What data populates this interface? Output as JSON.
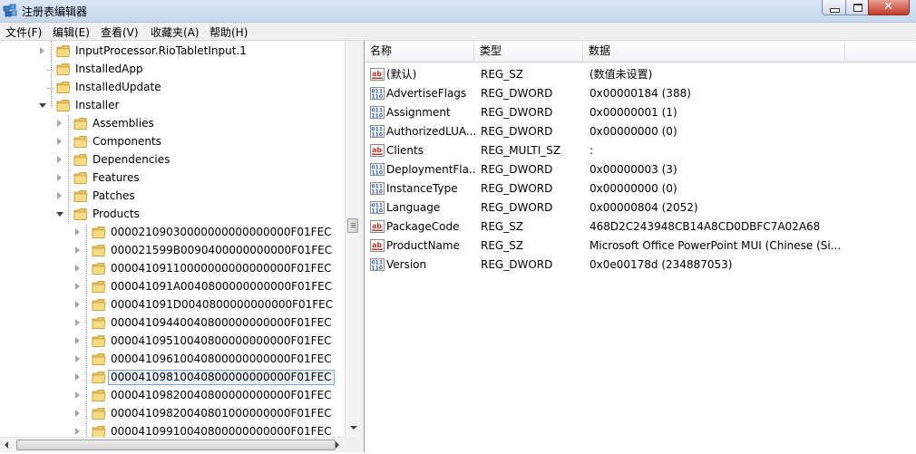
{
  "window": {
    "title": "注册表编辑器"
  },
  "menu": [
    "文件(F)",
    "编辑(E)",
    "查看(V)",
    "收藏夹(A)",
    "帮助(H)"
  ],
  "tree": {
    "items": [
      {
        "label": "InputProcessor.RioTabletInput.1",
        "level": 1,
        "expander": "closed"
      },
      {
        "label": "InstalledApp",
        "level": 1,
        "expander": "none"
      },
      {
        "label": "InstalledUpdate",
        "level": 1,
        "expander": "none"
      },
      {
        "label": "Installer",
        "level": 1,
        "expander": "open"
      },
      {
        "label": "Assemblies",
        "level": 2,
        "expander": "closed"
      },
      {
        "label": "Components",
        "level": 2,
        "expander": "closed"
      },
      {
        "label": "Dependencies",
        "level": 2,
        "expander": "closed"
      },
      {
        "label": "Features",
        "level": 2,
        "expander": "closed"
      },
      {
        "label": "Patches",
        "level": 2,
        "expander": "closed"
      },
      {
        "label": "Products",
        "level": 2,
        "expander": "open"
      },
      {
        "label": "00002109030000000000000000F01FEC",
        "level": 3,
        "expander": "closed"
      },
      {
        "label": "000021599B0090400000000000F01FEC",
        "level": 3,
        "expander": "closed"
      },
      {
        "label": "00004109110000000000000000F01FEC",
        "level": 3,
        "expander": "closed"
      },
      {
        "label": "000041091A0040800000000000F01FEC",
        "level": 3,
        "expander": "closed"
      },
      {
        "label": "000041091D0040800000000000F01FEC",
        "level": 3,
        "expander": "closed"
      },
      {
        "label": "00004109440040800000000000F01FEC",
        "level": 3,
        "expander": "closed"
      },
      {
        "label": "00004109510040800000000000F01FEC",
        "level": 3,
        "expander": "closed"
      },
      {
        "label": "00004109610040800000000000F01FEC",
        "level": 3,
        "expander": "closed"
      },
      {
        "label": "00004109810040800000000000F01FEC",
        "level": 3,
        "expander": "closed",
        "selected": true
      },
      {
        "label": "00004109820040800000000000F01FEC",
        "level": 3,
        "expander": "closed"
      },
      {
        "label": "00004109820040801000000000F01FEC",
        "level": 3,
        "expander": "closed"
      },
      {
        "label": "00004109910040800000000000F01FEC",
        "level": 3,
        "expander": "closed"
      }
    ]
  },
  "list": {
    "columns": [
      "名称",
      "类型",
      "数据"
    ],
    "rows": [
      {
        "name": "(默认)",
        "type": "REG_SZ",
        "data": "(数值未设置)",
        "icon": "string-value-icon"
      },
      {
        "name": "AdvertiseFlags",
        "type": "REG_DWORD",
        "data": "0x00000184 (388)",
        "icon": "binary-value-icon"
      },
      {
        "name": "Assignment",
        "type": "REG_DWORD",
        "data": "0x00000001 (1)",
        "icon": "binary-value-icon"
      },
      {
        "name": "AuthorizedLUA...",
        "type": "REG_DWORD",
        "data": "0x00000000 (0)",
        "icon": "binary-value-icon"
      },
      {
        "name": "Clients",
        "type": "REG_MULTI_SZ",
        "data": ":",
        "icon": "string-value-icon"
      },
      {
        "name": "DeploymentFla...",
        "type": "REG_DWORD",
        "data": "0x00000003 (3)",
        "icon": "binary-value-icon"
      },
      {
        "name": "InstanceType",
        "type": "REG_DWORD",
        "data": "0x00000000 (0)",
        "icon": "binary-value-icon"
      },
      {
        "name": "Language",
        "type": "REG_DWORD",
        "data": "0x00000804 (2052)",
        "icon": "binary-value-icon"
      },
      {
        "name": "PackageCode",
        "type": "REG_SZ",
        "data": "468D2C243948CB14A8CD0DBFC7A02A68",
        "icon": "string-value-icon"
      },
      {
        "name": "ProductName",
        "type": "REG_SZ",
        "data": "Microsoft Office PowerPoint MUI (Chinese (Si...",
        "icon": "string-value-icon"
      },
      {
        "name": "Version",
        "type": "REG_DWORD",
        "data": "0x0e00178d (234887053)",
        "icon": "binary-value-icon"
      }
    ]
  }
}
